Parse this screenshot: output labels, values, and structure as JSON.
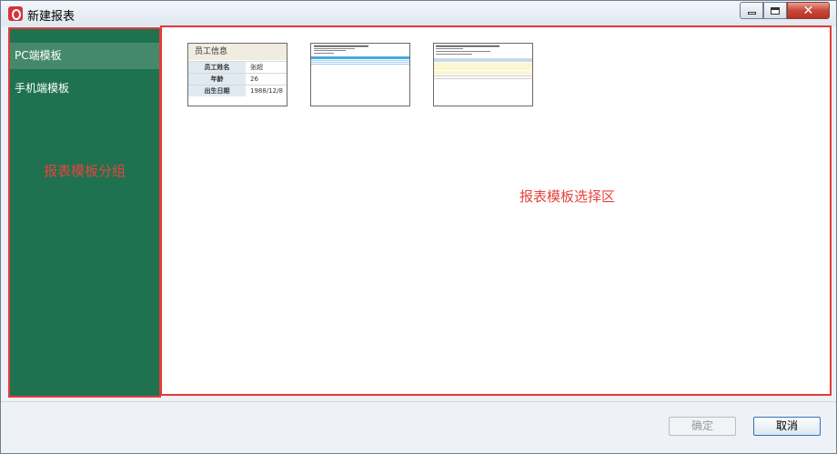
{
  "window": {
    "title": "新建报表"
  },
  "sidebar": {
    "items": [
      {
        "label": "PC端模板",
        "active": true
      },
      {
        "label": "手机端模板",
        "active": false
      }
    ],
    "annotation": "报表模板分组"
  },
  "main": {
    "annotation": "报表模板选择区",
    "templates": [
      {
        "kind": "table",
        "header": "员工信息",
        "rows": [
          {
            "key": "员工姓名",
            "value": "张超"
          },
          {
            "key": "年龄",
            "value": "26"
          },
          {
            "key": "出生日期",
            "value": "1988/12/8"
          }
        ]
      },
      {
        "kind": "list-preview"
      },
      {
        "kind": "report-preview"
      }
    ]
  },
  "footer": {
    "ok_label": "确定",
    "cancel_label": "取消"
  },
  "colors": {
    "sidebar_bg": "#1f7250",
    "sidebar_active": "#45896b",
    "annotation": "#e5443e",
    "highlight_border": "#e23a3a"
  }
}
